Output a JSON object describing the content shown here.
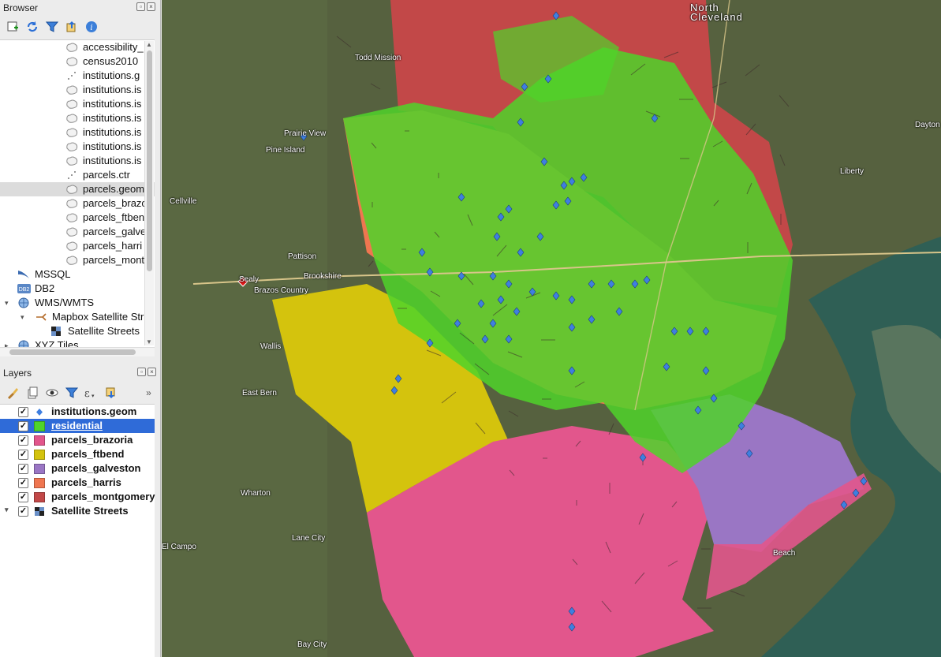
{
  "browser": {
    "title": "Browser",
    "items": [
      {
        "label": "accessibility_",
        "icon": "polygon-layer-icon"
      },
      {
        "label": "census2010",
        "icon": "polygon-layer-icon"
      },
      {
        "label": "institutions.g",
        "icon": "point-layer-icon"
      },
      {
        "label": "institutions.is",
        "icon": "polygon-layer-icon"
      },
      {
        "label": "institutions.is",
        "icon": "polygon-layer-icon"
      },
      {
        "label": "institutions.is",
        "icon": "polygon-layer-icon"
      },
      {
        "label": "institutions.is",
        "icon": "polygon-layer-icon"
      },
      {
        "label": "institutions.is",
        "icon": "polygon-layer-icon"
      },
      {
        "label": "institutions.is",
        "icon": "polygon-layer-icon"
      },
      {
        "label": "parcels.ctr",
        "icon": "point-layer-icon"
      },
      {
        "label": "parcels.geom",
        "icon": "polygon-layer-icon"
      },
      {
        "label": "parcels_brazo",
        "icon": "polygon-layer-icon"
      },
      {
        "label": "parcels_ftben",
        "icon": "polygon-layer-icon"
      },
      {
        "label": "parcels_galve",
        "icon": "polygon-layer-icon"
      },
      {
        "label": "parcels_harri",
        "icon": "polygon-layer-icon"
      },
      {
        "label": "parcels_mont",
        "icon": "polygon-layer-icon"
      }
    ],
    "connections": [
      {
        "label": "MSSQL",
        "icon": "mssql-icon"
      },
      {
        "label": "DB2",
        "icon": "db2-icon"
      },
      {
        "label": "WMS/WMTS",
        "icon": "globe-icon"
      },
      {
        "label": "Mapbox Satellite Str",
        "icon": "wms-connection-icon"
      },
      {
        "label": "Satellite Streets",
        "icon": "raster-layer-icon"
      },
      {
        "label": "XYZ Tiles",
        "icon": "globe-icon"
      }
    ]
  },
  "layers": {
    "title": "Layers",
    "items": [
      {
        "label": "institutions.geom",
        "color": "#3f7fe0",
        "symbol": "diamond",
        "checked": "✓"
      },
      {
        "label": "residential",
        "color": "#4fd42a",
        "symbol": "square",
        "checked": "✓"
      },
      {
        "label": "parcels_brazoria",
        "color": "#e2568c",
        "symbol": "square",
        "checked": "✓"
      },
      {
        "label": "parcels_ftbend",
        "color": "#d4c30d",
        "symbol": "square",
        "checked": "✓"
      },
      {
        "label": "parcels_galveston",
        "color": "#9a76c4",
        "symbol": "square",
        "checked": "✓"
      },
      {
        "label": "parcels_harris",
        "color": "#ef7650",
        "symbol": "square",
        "checked": "✓"
      },
      {
        "label": "parcels_montgomery",
        "color": "#c24848",
        "symbol": "square",
        "checked": "✓"
      },
      {
        "label": "Satellite Streets",
        "color": "#333333",
        "symbol": "raster",
        "checked": "✓"
      }
    ]
  },
  "map": {
    "labels": [
      {
        "text": "North",
        "big": true
      },
      {
        "text": "Cleveland",
        "big": true
      },
      {
        "text": "Prairie View"
      },
      {
        "text": "Pine Island"
      },
      {
        "text": "Cellville"
      },
      {
        "text": "Pattison"
      },
      {
        "text": "Brazos Country"
      },
      {
        "text": "Brookshire"
      },
      {
        "text": "Sealy"
      },
      {
        "text": "Wallis"
      },
      {
        "text": "East Bern"
      },
      {
        "text": "Wharton"
      },
      {
        "text": "Lane City"
      },
      {
        "text": "El Campo"
      },
      {
        "text": "Bay City"
      },
      {
        "text": "Liberty"
      },
      {
        "text": "Dayton"
      },
      {
        "text": "Todd Mission"
      },
      {
        "text": "Beach"
      }
    ]
  }
}
